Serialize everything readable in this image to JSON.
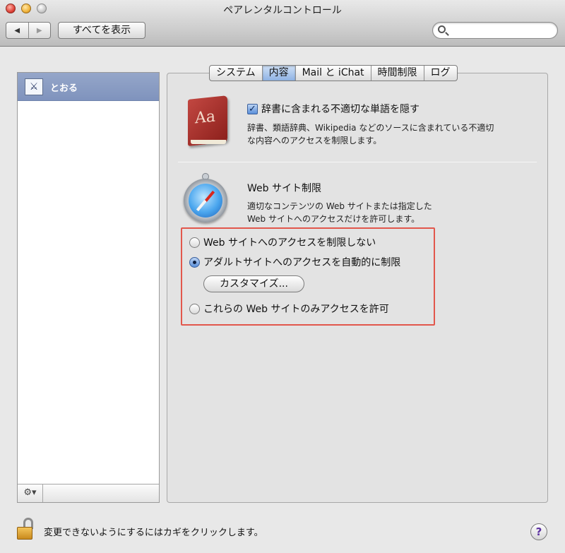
{
  "window": {
    "title": "ペアレンタルコントロール"
  },
  "toolbar": {
    "back_icon": "◀",
    "forward_icon": "▶",
    "show_all_label": "すべてを表示",
    "search": {
      "placeholder": "",
      "value": ""
    }
  },
  "sidebar": {
    "users": [
      {
        "name": "とおる",
        "avatar_icon": "dragonfly-icon"
      }
    ],
    "gear_label": "⚙▾"
  },
  "tabs": [
    {
      "label": "システム",
      "active": false
    },
    {
      "label": "内容",
      "active": true
    },
    {
      "label": "Mail と iChat",
      "active": false
    },
    {
      "label": "時間制限",
      "active": false
    },
    {
      "label": "ログ",
      "active": false
    }
  ],
  "content": {
    "dictionary": {
      "icon": "dictionary-icon",
      "icon_text": "Aa",
      "checkbox_label": "辞書に含まれる不適切な単語を隠す",
      "checked": true,
      "description_line1": "辞書、類語辞典、Wikipedia などのソースに含まれている不適切",
      "description_line2": "な内容へのアクセスを制限します。"
    },
    "website": {
      "icon": "safari-compass-icon",
      "title": "Web サイト制限",
      "description_line1": "適切なコンテンツの Web サイトまたは指定した",
      "description_line2": "Web サイトへのアクセスだけを許可します。",
      "options": [
        {
          "label": "Web サイトへのアクセスを制限しない",
          "selected": false
        },
        {
          "label": "アダルトサイトへのアクセスを自動的に制限",
          "selected": true
        },
        {
          "label": "これらの Web サイトのみアクセスを許可",
          "selected": false
        }
      ],
      "customize_label": "カスタマイズ...",
      "highlight_color": "#e2574c"
    }
  },
  "footer": {
    "lock_text": "変更できないようにするにはカギをクリックします。",
    "help_label": "?"
  }
}
